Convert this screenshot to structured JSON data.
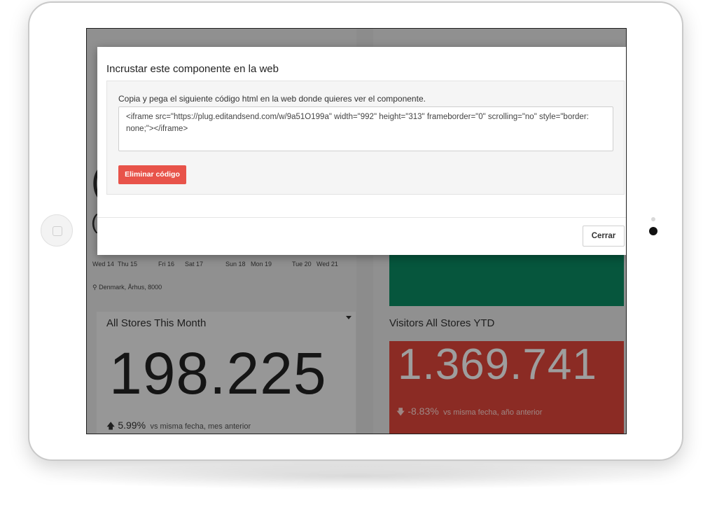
{
  "modal": {
    "title": "Incrustar este componente en la web",
    "instruction": "Copia y pega el siguiente código html en la web donde quieres ver el componente.",
    "code": "<iframe src=\"https://plug.editandsend.com/w/9a51O199a\" width=\"992\" height=\"313\" frameborder=\"0\" scrolling=\"no\" style=\"border: none;\"></iframe>",
    "delete_label": "Eliminar código",
    "close_label": "Cerrar"
  },
  "background": {
    "weather_days": [
      "Wed 14",
      "Thu 15",
      "Fri 16",
      "Sat 17",
      "Sun 18",
      "Mon 19",
      "Tue 20",
      "Wed 21"
    ],
    "location": "Denmark, Århus, 8000",
    "left_panel": {
      "title": "All Stores This Month",
      "value": "198.225",
      "change_pct": "5.99%",
      "change_note": "vs misma fecha, mes anterior"
    },
    "right_panel": {
      "title": "Visitors All Stores YTD",
      "value": "1.369.741",
      "change_pct": "-8.83%",
      "change_note": "vs misma fecha, año anterior"
    }
  },
  "colors": {
    "accent_red": "#e8534a",
    "panel_red": "#e0463b",
    "panel_green": "#0b8c63"
  }
}
